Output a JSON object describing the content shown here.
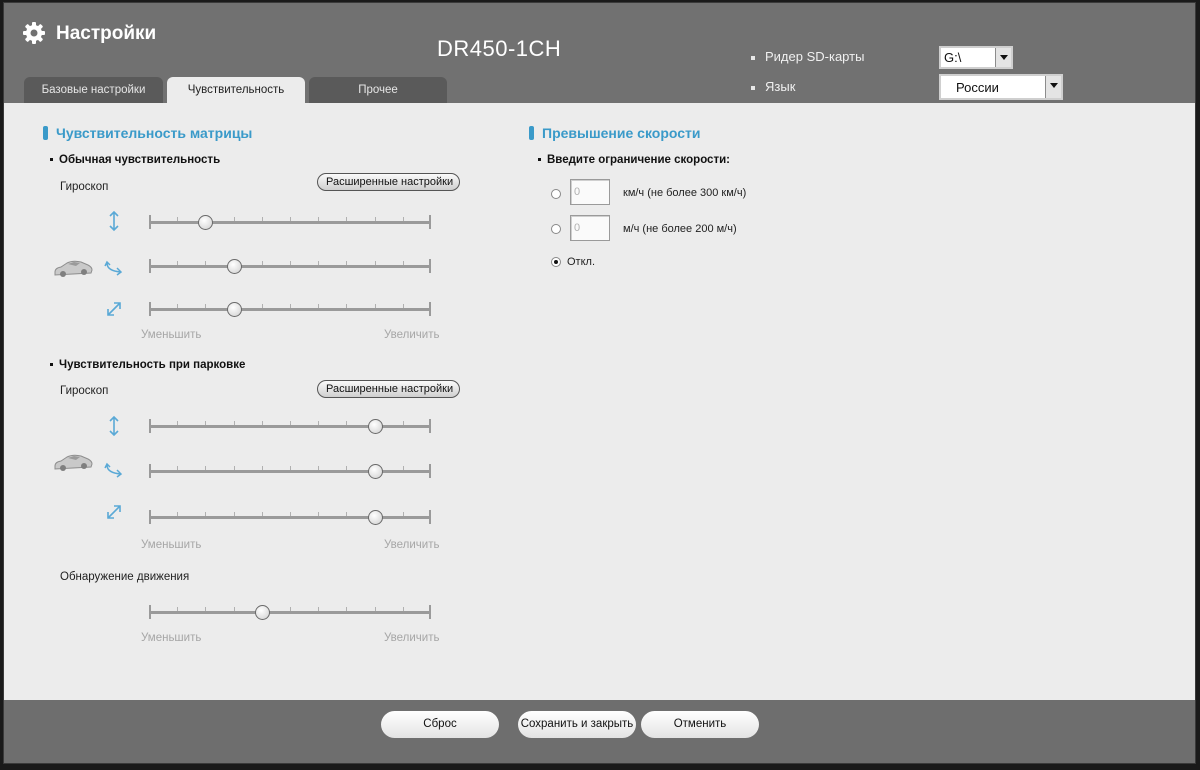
{
  "header": {
    "app_title": "Настройки",
    "model": "DR450-1CH",
    "gear_icon": "gear-icon"
  },
  "tabs": [
    {
      "label": "Базовые настройки",
      "active": false
    },
    {
      "label": "Чувствительность",
      "active": true
    },
    {
      "label": "Прочее",
      "active": false
    }
  ],
  "top_right": {
    "sd_reader_label": "Ридер SD-карты",
    "sd_reader_value": "G:\\",
    "language_label": "Язык",
    "language_value": "России"
  },
  "sensor_section": {
    "title": "Чувствительность матрицы",
    "normal": {
      "heading": "Обычная чувствительность",
      "gyro_label": "Гироскоп",
      "advanced_button": "Расширенные настройки",
      "slider_values": [
        0.2,
        0.3,
        0.3
      ],
      "decrease": "Уменьшить",
      "increase": "Увеличить"
    },
    "parking": {
      "heading": "Чувствительность при парковке",
      "gyro_label": "Гироскоп",
      "advanced_button": "Расширенные настройки",
      "slider_values": [
        0.8,
        0.8,
        0.8
      ],
      "decrease": "Уменьшить",
      "increase": "Увеличить"
    },
    "motion": {
      "label": "Обнаружение движения",
      "slider_value": 0.4,
      "decrease": "Уменьшить",
      "increase": "Увеличить"
    },
    "icons": [
      "vertical-axis-icon",
      "horizontal-axis-icon",
      "diagonal-axis-icon",
      "car-icon"
    ]
  },
  "speed_section": {
    "title": "Превышение скорости",
    "prompt": "Введите ограничение скорости:",
    "kmh_value": "0",
    "kmh_label": "км/ч (не более 300 км/ч)",
    "mph_value": "0",
    "mph_label": "м/ч (не более 200 м/ч)",
    "off_label": "Откл.",
    "selected": "off"
  },
  "footer": {
    "reset": "Сброс",
    "save_close": "Сохранить и закрыть",
    "cancel": "Отменить"
  },
  "colors": {
    "accent": "#3a9ac9",
    "header_bg": "#717171",
    "content_bg": "#ececec"
  }
}
